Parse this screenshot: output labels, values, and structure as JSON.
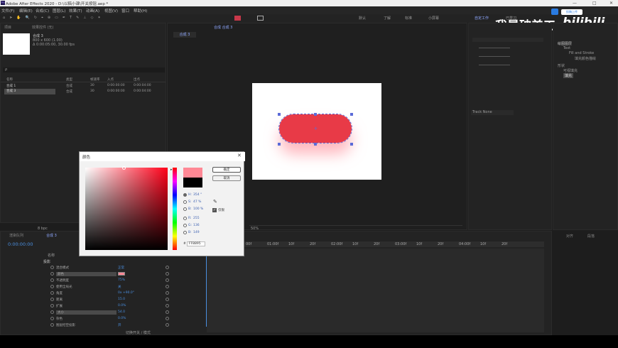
{
  "window": {
    "title": "Adobe After Effects 2020 - D:\\以稿小课\\开关按钮.aep *",
    "app_icon": "Ae"
  },
  "menu": [
    "文件(F)",
    "编辑(E)",
    "合成(C)",
    "图层(L)",
    "效果(T)",
    "动画(A)",
    "视图(V)",
    "窗口",
    "帮助(H)"
  ],
  "workspaces": [
    "默认",
    "了解",
    "标准",
    "小屏幕",
    "自定工作",
    "已学习"
  ],
  "watermark": {
    "text": "我是破美工",
    "logo": "bilibili"
  },
  "project": {
    "tab": "项目",
    "tab2": "效果控件 (无)",
    "comp_name": "合成 3",
    "comp_info1": "800 x 600 (1.00)",
    "comp_info2": "Δ 0:00:05:00, 30.00 fps",
    "search_placeholder": "ρ",
    "headers": [
      "名称",
      "类型",
      "帧速率",
      "入点",
      "出点"
    ],
    "items": [
      {
        "name": "合成 1",
        "type": "合成",
        "fps": "30",
        "in": "0:00:00:00",
        "out": "0:00:04:00"
      },
      {
        "name": "合成 3",
        "type": "合成",
        "fps": "30",
        "in": "0:00:00:00",
        "out": "0:00:04:00"
      }
    ],
    "bpc": "8 bpc"
  },
  "viewer": {
    "tab": "合成 合成 3",
    "subtab": "合成 3",
    "zoom": "50%"
  },
  "right_panel": {
    "tab": "对齐",
    "tab2": "段落",
    "tree_title": "绘图图层",
    "tree": [
      "Text",
      "Fill and Stroke",
      "填充颜色描绘",
      "形状",
      "可视填充",
      "填充"
    ],
    "track_label": "Track None"
  },
  "color_dialog": {
    "title": "颜色",
    "ok": "确定",
    "cancel": "取消",
    "hsb": [
      {
        "label": "H:",
        "value": "354 °",
        "selected": true
      },
      {
        "label": "S:",
        "value": "47 %",
        "selected": false
      },
      {
        "label": "B:",
        "value": "100 %",
        "selected": false
      }
    ],
    "rgb": [
      {
        "label": "R:",
        "value": "255"
      },
      {
        "label": "G:",
        "value": "136"
      },
      {
        "label": "B:",
        "value": "149"
      }
    ],
    "hex": "FF8895",
    "preview_new": "#ff8895",
    "preview_old": "#000000",
    "checkbox_label": "仅限",
    "hue_color": "#ff0019"
  },
  "timeline": {
    "tab": "渲染队列",
    "tab2": "合成 3",
    "timecode": "0:00:00:00",
    "layer_header": "名称",
    "ticks": [
      "00f",
      "01:00f",
      "10f",
      "20f",
      "02:00f",
      "10f",
      "20f",
      "03:00f",
      "10f",
      "20f",
      "04:00f",
      "10f",
      "20f"
    ],
    "section_title": "投影",
    "properties": [
      {
        "name": "混合模式",
        "value": "正常"
      },
      {
        "name": "颜色",
        "value": "",
        "swatch": "#ff8895"
      },
      {
        "name": "不透明度",
        "value": "75%"
      },
      {
        "name": "使用全局光",
        "value": "关"
      },
      {
        "name": "角度",
        "value": "0x +90.0°"
      },
      {
        "name": "距离",
        "value": "15.0"
      },
      {
        "name": "扩展",
        "value": "0.0%"
      },
      {
        "name": "大小",
        "value": "54.0"
      },
      {
        "name": "杂色",
        "value": "0.0%"
      },
      {
        "name": "图层挖空投影",
        "value": "开"
      }
    ],
    "footer": "切换开关 / 模式"
  },
  "colors": {
    "accent": "#4a8fe0",
    "toggle": "#e83a47",
    "handle": "#5b6bd8"
  }
}
